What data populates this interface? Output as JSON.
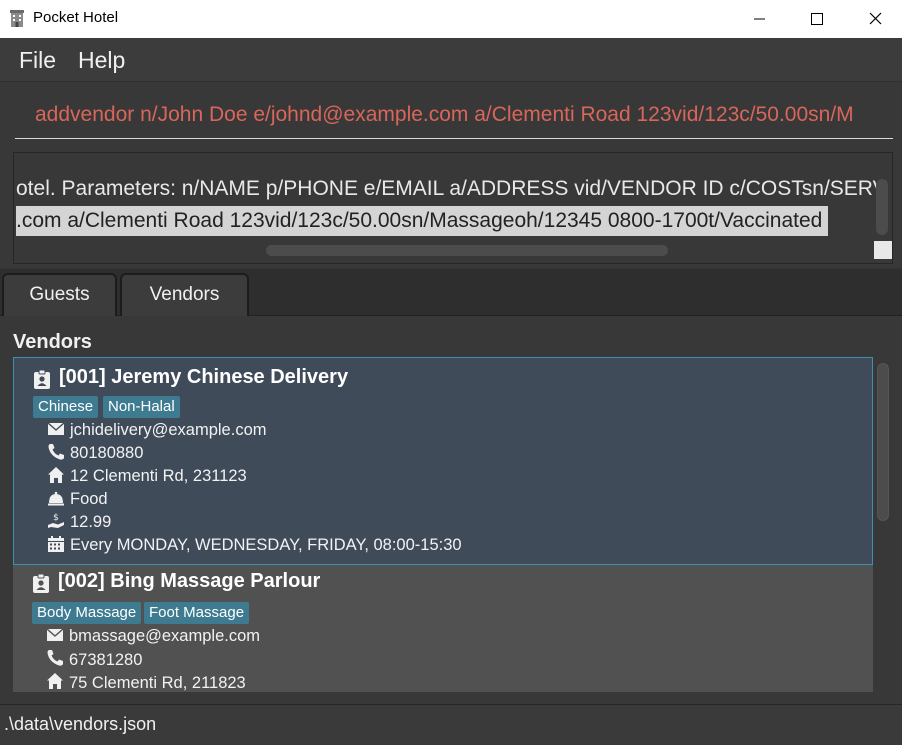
{
  "window": {
    "title": "Pocket Hotel",
    "icons": {
      "app": "hotel-icon",
      "minimize": "minimize-icon",
      "maximize": "maximize-icon",
      "close": "close-icon"
    }
  },
  "menu": {
    "file": "File",
    "help": "Help"
  },
  "command": {
    "value": "addvendor n/John Doe e/johnd@example.com a/Clementi Road 123vid/123c/50.00sn/M"
  },
  "result": {
    "line1": "otel. Parameters: n/NAME p/PHONE e/EMAIL a/ADDRESS vid/VENDOR ID c/COSTsn/SERV",
    "line2": ".com a/Clementi Road 123vid/123c/50.00sn/Massageoh/12345 0800-1700t/Vaccinated"
  },
  "tabs": {
    "guests": "Guests",
    "vendors": "Vendors"
  },
  "panel": {
    "title": "Vendors"
  },
  "vendors": [
    {
      "id": "[001]",
      "name": "Jeremy Chinese Delivery",
      "tags": [
        "Chinese",
        "Non-Halal"
      ],
      "email": "jchidelivery@example.com",
      "phone": "80180880",
      "address": "12 Clementi Rd, 231123",
      "service": "Food",
      "cost": "12.99",
      "hours": "Every MONDAY, WEDNESDAY, FRIDAY,  08:00-15:30"
    },
    {
      "id": "[002]",
      "name": "Bing Massage Parlour",
      "tags": [
        "Body Massage",
        "Foot Massage"
      ],
      "email": "bmassage@example.com",
      "phone": "67381280",
      "address": "75 Clementi Rd, 211823"
    }
  ],
  "status": {
    "path": ".\\data\\vendors.json"
  },
  "colors": {
    "background": "#383838",
    "command_text": "#d8665a",
    "selected_card": "#3f4b59",
    "selected_border": "#3d8fb3",
    "card": "#515151",
    "tag": "#3e7b91"
  }
}
